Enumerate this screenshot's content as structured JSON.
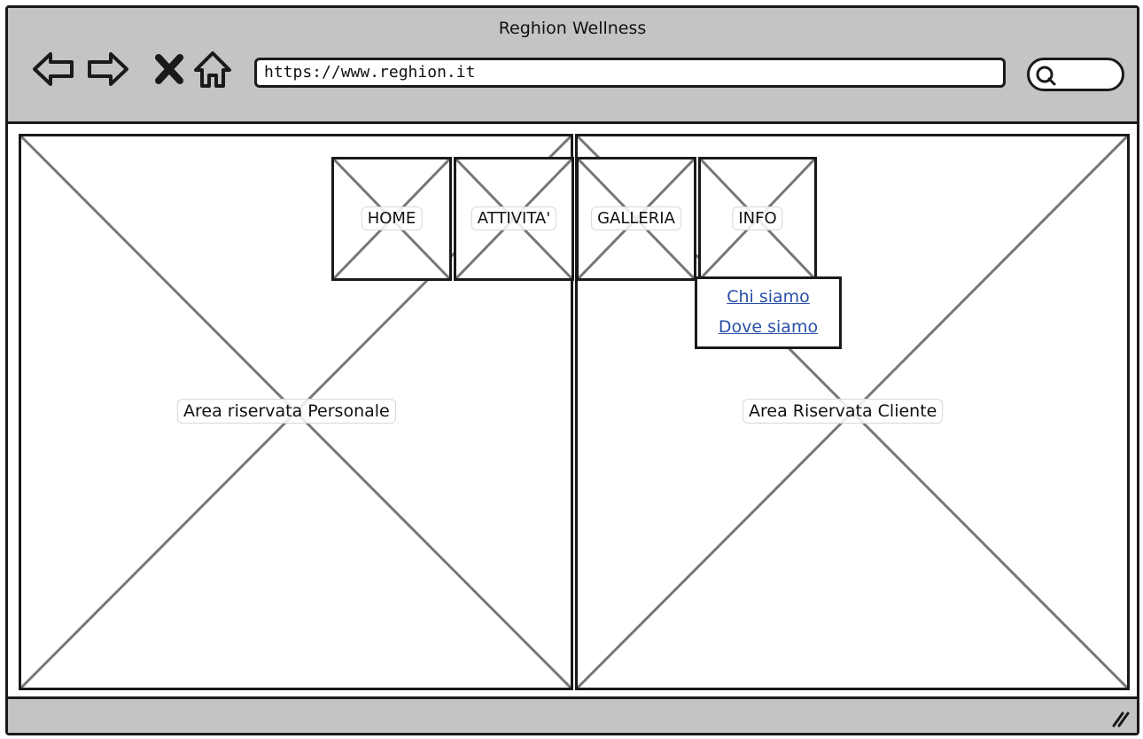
{
  "window": {
    "title": "Reghion Wellness"
  },
  "toolbar": {
    "back_icon": "arrow-left-icon",
    "forward_icon": "arrow-right-icon",
    "stop_icon": "close-icon",
    "home_icon": "home-icon",
    "url": "https://www.reghion.it",
    "search_icon": "search-icon"
  },
  "menu": {
    "items": [
      {
        "label": "HOME"
      },
      {
        "label": "ATTIVITA'"
      },
      {
        "label": "GALLERIA"
      },
      {
        "label": "INFO"
      }
    ],
    "info_dropdown": [
      {
        "label": "Chi siamo"
      },
      {
        "label": "Dove siamo"
      }
    ]
  },
  "panels": {
    "left_label": "Area riservata Personale",
    "right_label": "Area Riservata Cliente"
  },
  "colors": {
    "chrome": "#c4c4c4",
    "border": "#1a1a1a",
    "link": "#2a4fa8",
    "placeholder_cross": "#777777"
  }
}
